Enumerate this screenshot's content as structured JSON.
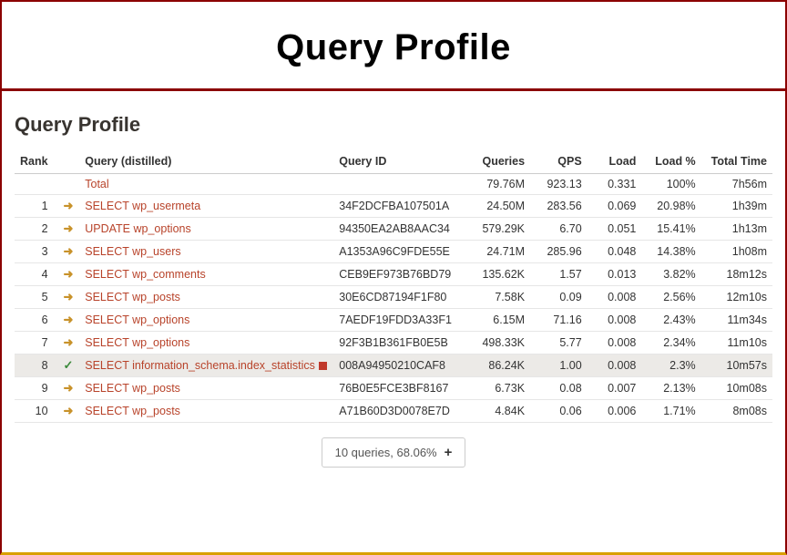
{
  "header": {
    "title": "Query Profile"
  },
  "section": {
    "title": "Query Profile"
  },
  "columns": {
    "rank": "Rank",
    "query": "Query (distilled)",
    "query_id": "Query ID",
    "queries": "Queries",
    "qps": "QPS",
    "load": "Load",
    "load_pct": "Load %",
    "total_time": "Total Time"
  },
  "total_row": {
    "label": "Total",
    "queries": "79.76M",
    "qps": "923.13",
    "load": "0.331",
    "load_pct": "100%",
    "total_time": "7h56m"
  },
  "rows": [
    {
      "rank": "1",
      "icon": "arrow",
      "query": "SELECT wp_usermeta",
      "marker": false,
      "query_id": "34F2DCFBA107501A",
      "queries": "24.50M",
      "qps": "283.56",
      "load": "0.069",
      "load_pct": "20.98%",
      "total_time": "1h39m"
    },
    {
      "rank": "2",
      "icon": "arrow",
      "query": "UPDATE wp_options",
      "marker": false,
      "query_id": "94350EA2AB8AAC34",
      "queries": "579.29K",
      "qps": "6.70",
      "load": "0.051",
      "load_pct": "15.41%",
      "total_time": "1h13m"
    },
    {
      "rank": "3",
      "icon": "arrow",
      "query": "SELECT wp_users",
      "marker": false,
      "query_id": "A1353A96C9FDE55E",
      "queries": "24.71M",
      "qps": "285.96",
      "load": "0.048",
      "load_pct": "14.38%",
      "total_time": "1h08m"
    },
    {
      "rank": "4",
      "icon": "arrow",
      "query": "SELECT wp_comments",
      "marker": false,
      "query_id": "CEB9EF973B76BD79",
      "queries": "135.62K",
      "qps": "1.57",
      "load": "0.013",
      "load_pct": "3.82%",
      "total_time": "18m12s"
    },
    {
      "rank": "5",
      "icon": "arrow",
      "query": "SELECT wp_posts",
      "marker": false,
      "query_id": "30E6CD87194F1F80",
      "queries": "7.58K",
      "qps": "0.09",
      "load": "0.008",
      "load_pct": "2.56%",
      "total_time": "12m10s"
    },
    {
      "rank": "6",
      "icon": "arrow",
      "query": "SELECT wp_options",
      "marker": false,
      "query_id": "7AEDF19FDD3A33F1",
      "queries": "6.15M",
      "qps": "71.16",
      "load": "0.008",
      "load_pct": "2.43%",
      "total_time": "11m34s"
    },
    {
      "rank": "7",
      "icon": "arrow",
      "query": "SELECT wp_options",
      "marker": false,
      "query_id": "92F3B1B361FB0E5B",
      "queries": "498.33K",
      "qps": "5.77",
      "load": "0.008",
      "load_pct": "2.34%",
      "total_time": "11m10s"
    },
    {
      "rank": "8",
      "icon": "check",
      "query": "SELECT information_schema.index_statistics",
      "marker": true,
      "query_id": "008A94950210CAF8",
      "queries": "86.24K",
      "qps": "1.00",
      "load": "0.008",
      "load_pct": "2.3%",
      "total_time": "10m57s",
      "highlight": true
    },
    {
      "rank": "9",
      "icon": "arrow",
      "query": "SELECT wp_posts",
      "marker": false,
      "query_id": "76B0E5FCE3BF8167",
      "queries": "6.73K",
      "qps": "0.08",
      "load": "0.007",
      "load_pct": "2.13%",
      "total_time": "10m08s"
    },
    {
      "rank": "10",
      "icon": "arrow",
      "query": "SELECT wp_posts",
      "marker": false,
      "query_id": "A71B60D3D0078E7D",
      "queries": "4.84K",
      "qps": "0.06",
      "load": "0.006",
      "load_pct": "1.71%",
      "total_time": "8m08s"
    }
  ],
  "footer": {
    "summary": "10 queries, 68.06%"
  }
}
